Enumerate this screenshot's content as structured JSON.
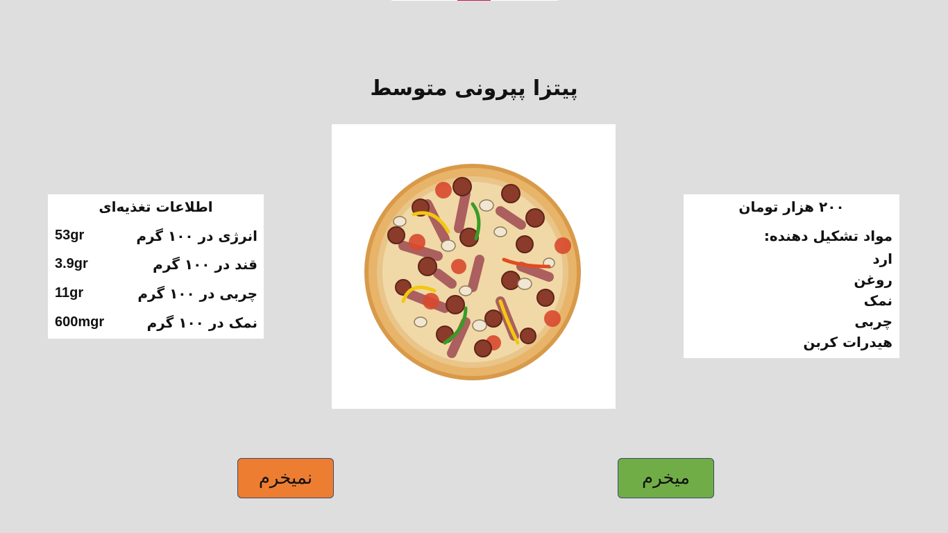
{
  "product": {
    "title": "پیتزا پپرونی متوسط",
    "image": "pepperoni-pizza"
  },
  "nutrition": {
    "title": "اطلاعات تغذیه‌ای",
    "rows": [
      {
        "label": "انرژی در ۱۰۰ گرم",
        "value": "53gr"
      },
      {
        "label": "قند در ۱۰۰ گرم",
        "value": "3.9gr"
      },
      {
        "label": "چربی در ۱۰۰ گرم",
        "value": "11gr"
      },
      {
        "label": "نمک در ۱۰۰ گرم",
        "value": "600mgr"
      }
    ]
  },
  "info": {
    "price": "۲۰۰ هزار تومان",
    "ingredients_title": "مواد تشکیل دهنده:",
    "ingredients": [
      "ارد",
      "روغن",
      "نمک",
      "چربی",
      "هیدرات کربن"
    ]
  },
  "buttons": {
    "reject_label": "نمیخرم",
    "buy_label": "میخرم"
  },
  "colors": {
    "background": "#dedede",
    "reject": "#ed7d31",
    "buy": "#70ad47",
    "accent": "#c2185b"
  }
}
